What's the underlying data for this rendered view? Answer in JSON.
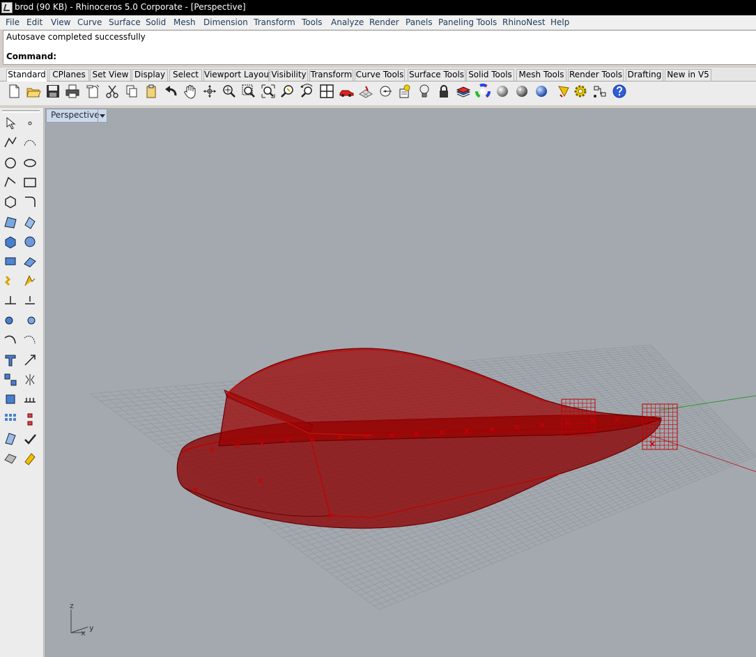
{
  "window": {
    "title": "brod (90 KB) - Rhinoceros  5.0 Corporate - [Perspective]"
  },
  "menu": [
    "File",
    "Edit",
    "View",
    "Curve",
    "Surface",
    "Solid",
    "Mesh",
    "Dimension",
    "Transform",
    "Tools",
    "Analyze",
    "Render",
    "Panels",
    "Paneling Tools",
    "RhinoNest",
    "Help"
  ],
  "history": {
    "message": "Autosave completed successfully"
  },
  "command": {
    "label": "Command:"
  },
  "tabs": [
    "Standard",
    "CPlanes",
    "Set View",
    "Display",
    "Select",
    "Viewport Layout",
    "Visibility",
    "Transform",
    "Curve Tools",
    "Surface Tools",
    "Solid Tools",
    "Mesh Tools",
    "Render Tools",
    "Drafting",
    "New in V5"
  ],
  "toolbar_icons": [
    "new-file-icon",
    "open-folder-icon",
    "save-icon",
    "print-icon",
    "import-icon",
    "cut-icon",
    "copy-icon",
    "paste-icon",
    "undo-icon",
    "pan-hand-icon",
    "rotate-view-icon",
    "zoom-dynamic-icon",
    "zoom-window-icon",
    "zoom-extents-icon",
    "zoom-selected-icon",
    "undo-view-icon",
    "four-viewports-icon",
    "car-perspective-icon",
    "cplane-icon",
    "osnap-icon",
    "properties-icon",
    "light-bulb-icon",
    "lock-icon",
    "layer-icon",
    "color-wheel-icon",
    "shaded-sphere-icon",
    "rendered-sphere-icon",
    "blue-sphere-icon",
    "analysis-icon",
    "options-gear-icon",
    "grasshopper-icon",
    "help-icon"
  ],
  "left_tools": [
    [
      "select-arrow-icon",
      "point-icon"
    ],
    [
      "polyline-icon",
      "curve-control-points-icon"
    ],
    [
      "circle-icon",
      "ellipse-icon"
    ],
    [
      "arc-icon",
      "rectangle-icon"
    ],
    [
      "polygon-icon",
      "fillet-curve-icon"
    ],
    [
      "surface-from-points-icon",
      "extrude-icon"
    ],
    [
      "box-icon",
      "sphere-icon"
    ],
    [
      "cylinder-icon",
      "loft-icon"
    ],
    [
      "explode-icon",
      "split-icon"
    ],
    [
      "trim-icon",
      "extend-icon"
    ],
    [
      "boolean-union-icon",
      "boolean-split-icon"
    ],
    [
      "offset-icon",
      "blend-icon"
    ],
    [
      "text-icon",
      "scale-icon"
    ],
    [
      "group-icon",
      "mirror-icon"
    ],
    [
      "block-icon",
      "dimension-icon"
    ],
    [
      "array-icon",
      "align-icon"
    ],
    [
      "analyze-surface-icon",
      "check-icon"
    ],
    [
      "render-object-icon",
      "paint-bucket-icon"
    ]
  ],
  "viewport": {
    "name": "Perspective"
  },
  "axis_labels": {
    "z": "z",
    "x": "x",
    "y": "y"
  },
  "colors": {
    "hull_fill": "#8b0000",
    "hull_edge": "#c00000",
    "grid": "#8e939a",
    "viewport_bg": "#a4a9b0"
  }
}
